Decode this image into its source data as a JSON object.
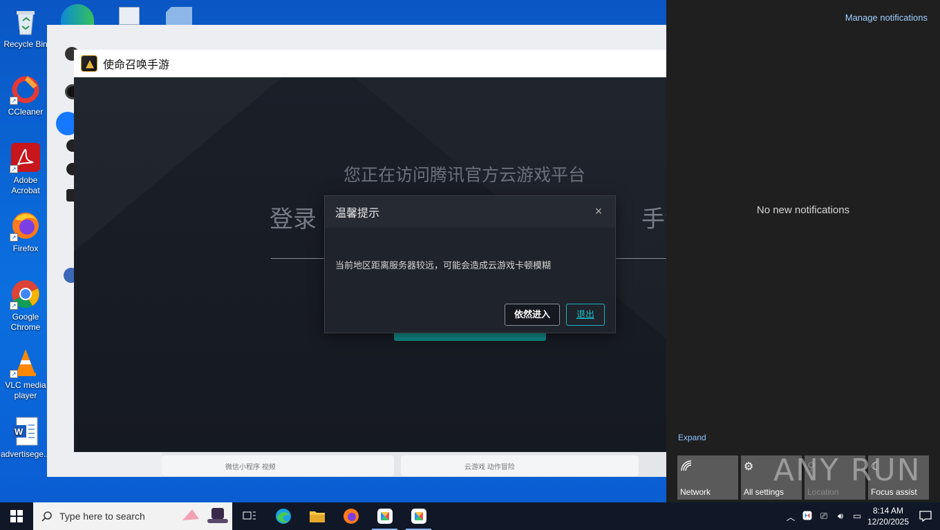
{
  "desktop": {
    "icons": [
      {
        "label": "Recycle Bin"
      },
      {
        "label": "CCleaner"
      },
      {
        "label": "Adobe Acrobat"
      },
      {
        "label": "Firefox"
      },
      {
        "label": "Google Chrome"
      },
      {
        "label": "VLC media player"
      },
      {
        "label": "advertisege..."
      }
    ]
  },
  "game_window": {
    "title": "使命召唤手游",
    "subtitle": "您正在访问腾讯官方云游戏平台",
    "headline_left": "登录",
    "headline_right": "手游》"
  },
  "dialog": {
    "title": "温馨提示",
    "message": "当前地区距离服务器较远，可能会造成云游戏卡顿模糊",
    "continue_label": "依然进入",
    "exit_label": "退出",
    "close_glyph": "×"
  },
  "action_center": {
    "manage_label": "Manage notifications",
    "empty_label": "No new notifications",
    "expand_label": "Expand",
    "tiles": [
      {
        "label": "Network",
        "icon": "network-icon"
      },
      {
        "label": "All settings",
        "icon": "gear-icon"
      },
      {
        "label": "Location",
        "icon": "location-icon"
      },
      {
        "label": "Focus assist",
        "icon": "moon-icon"
      }
    ],
    "watermark": "ANY RUN"
  },
  "taskbar": {
    "search_placeholder": "Type here to search",
    "time": "8:14 AM",
    "date": "12/20/2025"
  },
  "background_app": {
    "text_a": "微信小程序 视频",
    "text_b": "云游戏 动作冒险"
  }
}
